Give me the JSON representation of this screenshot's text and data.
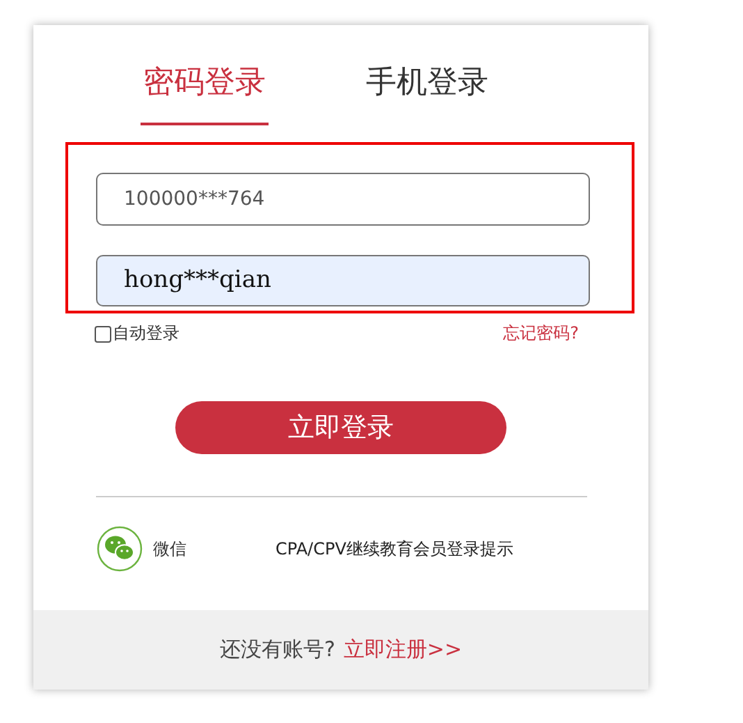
{
  "tabs": [
    {
      "label": "密码登录",
      "selected": true
    },
    {
      "label": "手机登录",
      "selected": false
    }
  ],
  "fields": [
    {
      "kind": "account",
      "value": "100000***764",
      "autofilled": false
    },
    {
      "kind": "password",
      "value": "hong***qian",
      "autofilled": true
    }
  ],
  "auto_login": {
    "label": "自动登录",
    "checked": false
  },
  "forgot_link": "忘记密码?",
  "login_button": "立即登录",
  "wechat": {
    "label": "微信"
  },
  "hint_link": "CPA/CPV继续教育会员登录提示",
  "footer": {
    "text": "还没有账号?",
    "link": "立即注册>>"
  }
}
